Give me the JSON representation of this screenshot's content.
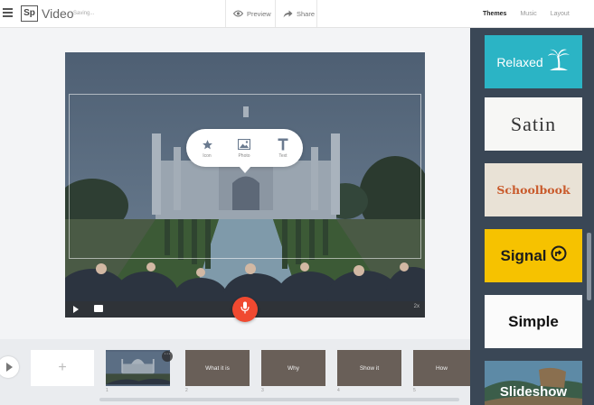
{
  "app": {
    "logo_text": "Sp",
    "title": "Video",
    "status": "Saving..."
  },
  "toolbar": {
    "preview_label": "Preview",
    "share_label": "Share"
  },
  "tabs": [
    {
      "label": "Themes",
      "active": true
    },
    {
      "label": "Music",
      "active": false
    },
    {
      "label": "Layout",
      "active": false
    }
  ],
  "popup": {
    "items": [
      {
        "label": "Icon",
        "icon": "star-icon"
      },
      {
        "label": "Photo",
        "icon": "photo-icon"
      },
      {
        "label": "Text",
        "icon": "text-icon"
      }
    ]
  },
  "player": {
    "speed": "2x"
  },
  "themes": [
    {
      "label": "Relaxed",
      "bg": "#2bb4c5",
      "color": "#ffffff"
    },
    {
      "label": "Satin",
      "bg": "#f7f7f5",
      "color": "#333333"
    },
    {
      "label": "Schoolbook",
      "bg": "#e9e2d6",
      "color": "#c95a2b"
    },
    {
      "label": "Signal",
      "bg": "#f6c200",
      "color": "#1c1c1c"
    },
    {
      "label": "Simple",
      "bg": "#fbfbfb",
      "color": "#111111"
    },
    {
      "label": "Slideshow",
      "bg": "#375a6b",
      "color": "#ffffff"
    }
  ],
  "timeline": {
    "add_label": "+",
    "slides": [
      {
        "label": "",
        "number": "1",
        "kind": "photo"
      },
      {
        "label": "What it is",
        "number": "2",
        "kind": "text"
      },
      {
        "label": "Why",
        "number": "3",
        "kind": "text"
      },
      {
        "label": "Show it",
        "number": "4",
        "kind": "text"
      },
      {
        "label": "How",
        "number": "5",
        "kind": "text"
      }
    ],
    "more_label": "···"
  },
  "colors": {
    "accent": "#f04930",
    "sidebar": "#3a4756",
    "slide_bg": "#695f58"
  }
}
